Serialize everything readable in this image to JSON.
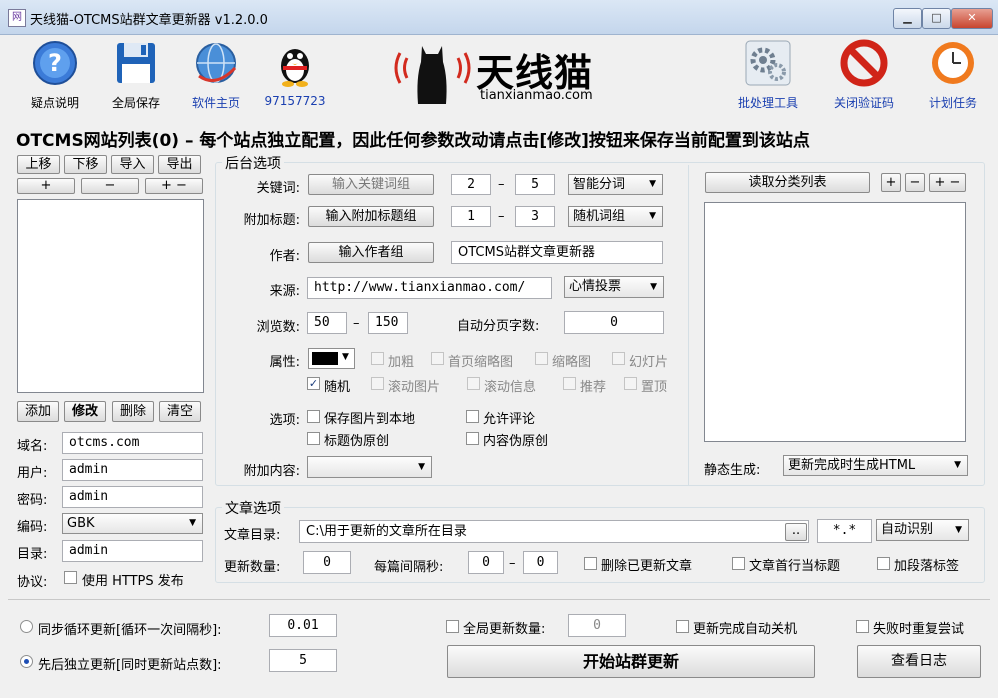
{
  "window": {
    "title": "天线猫-OTCMS站群文章更新器 v1.2.0.0",
    "app_icon": "网",
    "minimize": "▁",
    "maximize": "□",
    "close": "✕"
  },
  "toolbar": {
    "help": "疑点说明",
    "save": "全局保存",
    "home": "软件主页",
    "qq": "97157723",
    "batch": "批处理工具",
    "captcha": "关闭验证码",
    "schedule": "计划任务"
  },
  "logo": {
    "text": "天线猫",
    "sub": "tianxianmao.com"
  },
  "heading": "OTCMS网站列表(0) – 每个站点独立配置，因此任何参数改动请点击[修改]按钮来保存当前配置到该站点",
  "site_list": {
    "btn_up": "上移",
    "btn_down": "下移",
    "btn_import": "导入",
    "btn_export": "导出",
    "btn_plus": "+",
    "btn_minus": "−",
    "btn_plusminus": "+ −",
    "btn_add": "添加",
    "btn_edit": "修改",
    "btn_delete": "删除",
    "btn_clear": "清空",
    "domain_label": "域名:",
    "domain": "otcms.com",
    "user_label": "用户:",
    "user": "admin",
    "pass_label": "密码:",
    "pass": "admin",
    "enc_label": "编码:",
    "enc": "GBK",
    "dir_label": "目录:",
    "dir": "admin",
    "proto_label": "协议:",
    "https": "使用 HTTPS 发布"
  },
  "backend": {
    "group": "后台选项",
    "kw_label": "关键词:",
    "kw_btn": "输入关键词组",
    "kw_min": "2",
    "kw_max": "5",
    "kw_mode": "智能分词",
    "extra_label": "附加标题:",
    "extra_btn": "输入附加标题组",
    "extra_min": "1",
    "extra_max": "3",
    "extra_mode": "随机词组",
    "author_label": "作者:",
    "author_btn": "输入作者组",
    "author_value": "OTCMS站群文章更新器",
    "source_label": "来源:",
    "source_value": "http://www.tianxianmao.com/",
    "vote": "心情投票",
    "views_label": "浏览数:",
    "views_min": "50",
    "views_max": "150",
    "paging_label": "自动分页字数:",
    "paging_value": "0",
    "attr_label": "属性:",
    "bold": "加粗",
    "home_thumb": "首页缩略图",
    "thumb": "缩略图",
    "slide": "幻灯片",
    "random": "随机",
    "scroll_img": "滚动图片",
    "scroll_info": "滚动信息",
    "recommend": "推荐",
    "top": "置顶",
    "options_label": "选项:",
    "save_img": "保存图片到本地",
    "allow_comment": "允许评论",
    "title_orig": "标题伪原创",
    "content_orig": "内容伪原创",
    "append_label": "附加内容:",
    "append_value": "",
    "dash": "–"
  },
  "category": {
    "read_btn": "读取分类列表",
    "plus": "+",
    "minus": "−",
    "pm": "+ −",
    "static_label": "静态生成:",
    "static_value": "更新完成时生成HTML"
  },
  "article": {
    "group": "文章选项",
    "dir_label": "文章目录:",
    "dir_value": "C:\\用于更新的文章所在目录",
    "browse": "..",
    "ext": "*.*",
    "detect": "自动识别",
    "count_label": "更新数量:",
    "count": "0",
    "interval_label": "每篇间隔秒:",
    "int_min": "0",
    "int_max": "0",
    "delete_updated": "删除已更新文章",
    "first_line_title": "文章首行当标题",
    "para_tag": "加段落标签"
  },
  "bottom": {
    "sync_label": "同步循环更新[循环一次间隔秒]:",
    "sync_value": "0.01",
    "seq_label": "先后独立更新[同时更新站点数]:",
    "seq_value": "5",
    "global_count": "全局更新数量:",
    "global_value": "0",
    "shutdown": "更新完成自动关机",
    "retry": "失败时重复尝试",
    "start": "开始站群更新",
    "log": "查看日志"
  },
  "colors": {
    "accent_blue": "#1a3fb0",
    "logo_red": "#d22a1e"
  }
}
